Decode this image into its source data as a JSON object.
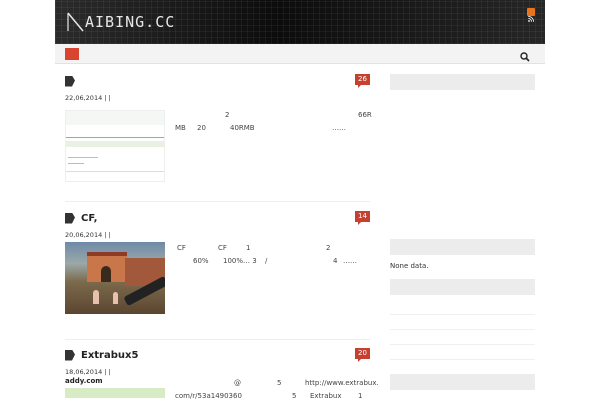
{
  "site": {
    "logo_text": "AIBING.CC"
  },
  "header": {
    "rss_icon": "rss-icon"
  },
  "nav": {
    "home_icon": "home-icon",
    "search_icon": "search-icon"
  },
  "posts": [
    {
      "title": "",
      "comments": "26",
      "meta": "22,06,2014 |    |",
      "excerpt_line1": [
        "2",
        "66R"
      ],
      "excerpt_line2": [
        "MB",
        "20",
        "40RMB",
        "……"
      ]
    },
    {
      "title": "CF,",
      "comments": "14",
      "meta": "20,06,2014 |    |",
      "excerpt_line1": [
        "CF",
        "CF",
        "1",
        "2"
      ],
      "excerpt_line2": [
        "60%",
        "100%… 3",
        "/",
        "4",
        "……"
      ]
    },
    {
      "title": "Extrabux5",
      "comments": "20",
      "meta": "18,06,2014 |    |",
      "thumb_title": "addy.com",
      "excerpt_line1": [
        "@",
        "5",
        "http://www.extrabux."
      ],
      "excerpt_line2": [
        "com/r/53a1490360",
        "5",
        "Extrabux",
        "1"
      ]
    }
  ],
  "sidebar": {
    "widgets": [
      {
        "title": ""
      },
      {
        "title": "",
        "text": "None data."
      },
      {
        "title": ""
      },
      {
        "title": ""
      }
    ]
  },
  "colors": {
    "accent": "#c7402f",
    "header_bg": "#161616",
    "nav_bg": "#f3f3f3"
  }
}
